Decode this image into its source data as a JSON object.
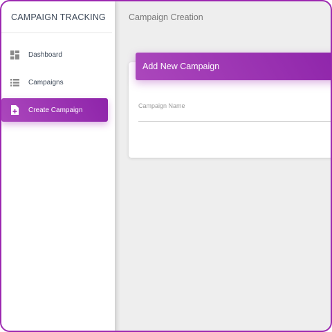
{
  "sidebar": {
    "brand": "CAMPAIGN TRACKING",
    "items": [
      {
        "label": "Dashboard",
        "icon": "dashboard-icon",
        "active": false
      },
      {
        "label": "Campaigns",
        "icon": "list-icon",
        "active": false
      },
      {
        "label": "Create Campaign",
        "icon": "new-file-icon",
        "active": true
      }
    ]
  },
  "topbar": {
    "title": "Campaign Creation"
  },
  "card": {
    "header": "Add New Campaign",
    "fields": [
      {
        "label": "Campaign Name",
        "value": ""
      }
    ]
  },
  "colors": {
    "accent": "#9c27b0",
    "accent_gradient_start": "#ab47bc",
    "accent_gradient_end": "#8e24aa",
    "background": "#eeeeee"
  }
}
